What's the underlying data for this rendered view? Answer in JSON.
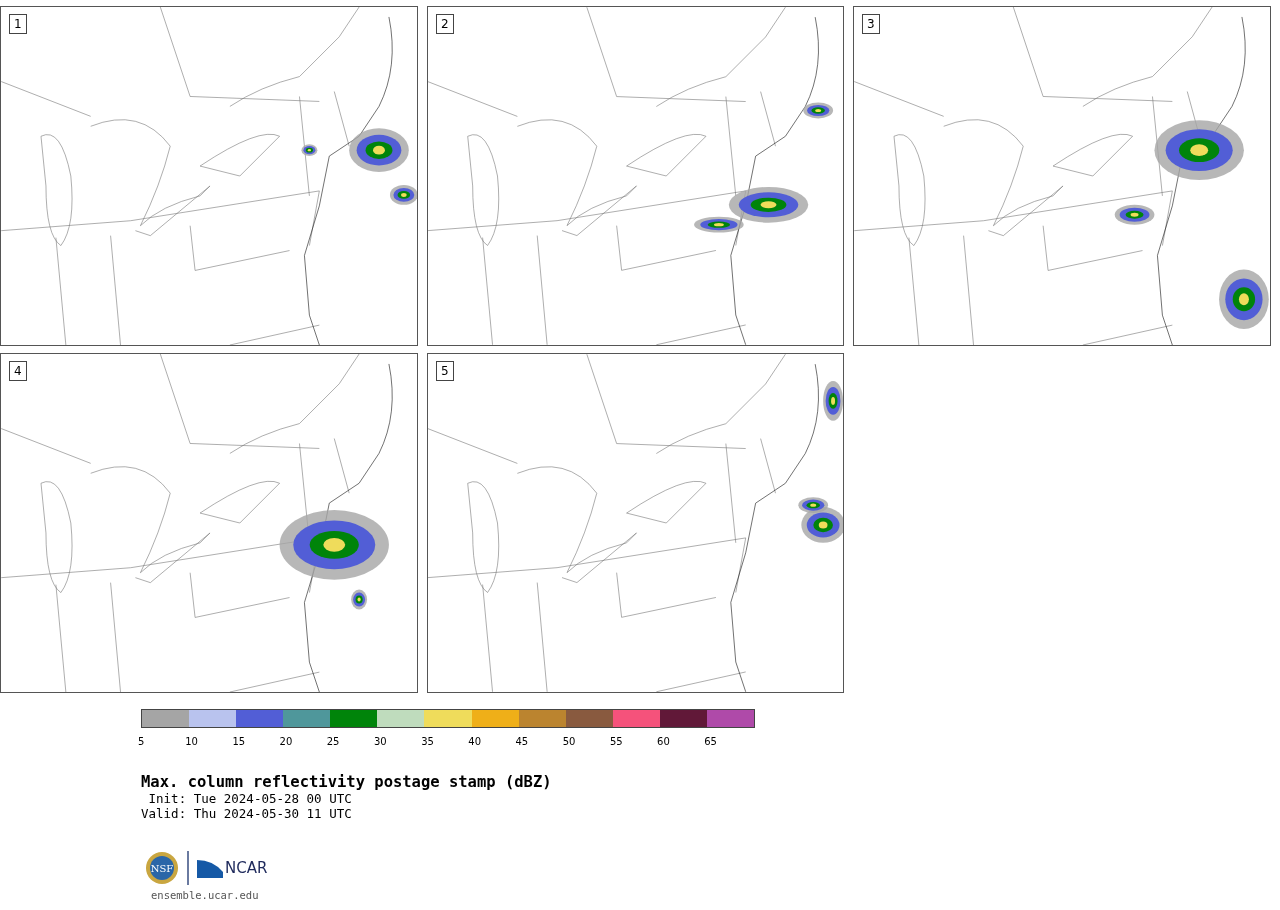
{
  "panels": [
    {
      "label": "1"
    },
    {
      "label": "2"
    },
    {
      "label": "3"
    },
    {
      "label": "4"
    },
    {
      "label": "5"
    }
  ],
  "colorbar": {
    "bins": [
      {
        "color": "#a5a5a5"
      },
      {
        "color": "#b9c3ee"
      },
      {
        "color": "#525ed6"
      },
      {
        "color": "#4f979b"
      },
      {
        "color": "#00840a"
      },
      {
        "color": "#bfdcbd"
      },
      {
        "color": "#efdc5b"
      },
      {
        "color": "#efaf18"
      },
      {
        "color": "#bb842f"
      },
      {
        "color": "#895a3f"
      },
      {
        "color": "#f5527b"
      },
      {
        "color": "#611838"
      },
      {
        "color": "#af4aa9"
      }
    ],
    "ticks": [
      "5",
      "10",
      "15",
      "20",
      "25",
      "30",
      "35",
      "40",
      "45",
      "50",
      "55",
      "60",
      "65"
    ]
  },
  "title": "Max. column reflectivity postage stamp (dBZ)",
  "init": " Init: Tue 2024-05-28 00 UTC",
  "valid": "Valid: Thu 2024-05-30 11 UTC",
  "logos": {
    "nsf": "NSF",
    "ncar": "NCAR"
  },
  "footer": "ensemble.ucar.edu"
}
